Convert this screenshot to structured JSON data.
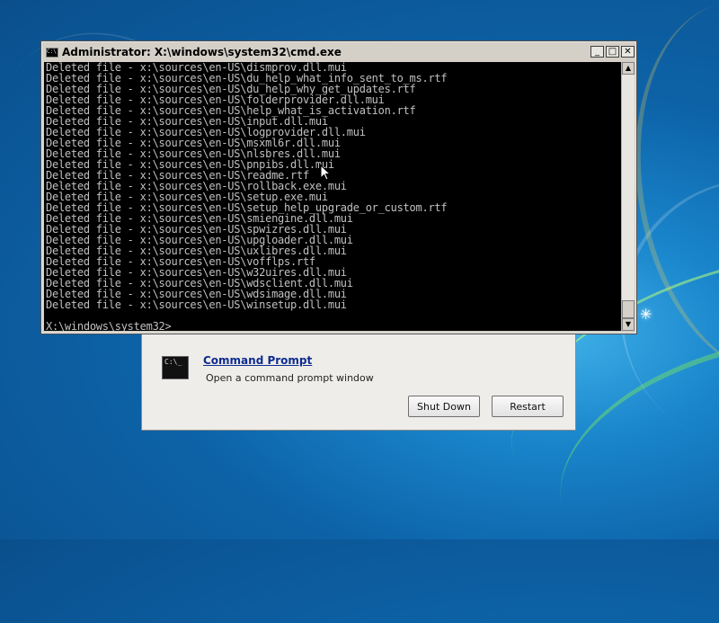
{
  "console_window": {
    "title": "Administrator: X:\\windows\\system32\\cmd.exe",
    "controls": {
      "minimize": "_",
      "maximize": "□",
      "close": "✕"
    },
    "output_lines": [
      "Deleted file - x:\\sources\\en-US\\dismprov.dll.mui",
      "Deleted file - x:\\sources\\en-US\\du_help_what_info_sent_to_ms.rtf",
      "Deleted file - x:\\sources\\en-US\\du_help_why_get_updates.rtf",
      "Deleted file - x:\\sources\\en-US\\folderprovider.dll.mui",
      "Deleted file - x:\\sources\\en-US\\help_what_is_activation.rtf",
      "Deleted file - x:\\sources\\en-US\\input.dll.mui",
      "Deleted file - x:\\sources\\en-US\\logprovider.dll.mui",
      "Deleted file - x:\\sources\\en-US\\msxml6r.dll.mui",
      "Deleted file - x:\\sources\\en-US\\nlsbres.dll.mui",
      "Deleted file - x:\\sources\\en-US\\pnpibs.dll.mui",
      "Deleted file - x:\\sources\\en-US\\readme.rtf",
      "Deleted file - x:\\sources\\en-US\\rollback.exe.mui",
      "Deleted file - x:\\sources\\en-US\\setup.exe.mui",
      "Deleted file - x:\\sources\\en-US\\setup_help_upgrade_or_custom.rtf",
      "Deleted file - x:\\sources\\en-US\\smiengine.dll.mui",
      "Deleted file - x:\\sources\\en-US\\spwizres.dll.mui",
      "Deleted file - x:\\sources\\en-US\\upgloader.dll.mui",
      "Deleted file - x:\\sources\\en-US\\uxlibres.dll.mui",
      "Deleted file - x:\\sources\\en-US\\vofflps.rtf",
      "Deleted file - x:\\sources\\en-US\\w32uires.dll.mui",
      "Deleted file - x:\\sources\\en-US\\wdsclient.dll.mui",
      "Deleted file - x:\\sources\\en-US\\wdsimage.dll.mui",
      "Deleted file - x:\\sources\\en-US\\winsetup.dll.mui"
    ],
    "prompt": "X:\\windows\\system32>"
  },
  "recovery_dialog": {
    "command_prompt_link": "Command Prompt",
    "command_prompt_desc": "Open a command prompt window",
    "icon_text": "C:\\_",
    "shut_down_label": "Shut Down",
    "restart_label": "Restart"
  },
  "colors": {
    "console_bg": "#000000",
    "console_fg": "#c0c0c0",
    "link": "#0e2c8e",
    "desktop": "#0d63a8"
  }
}
